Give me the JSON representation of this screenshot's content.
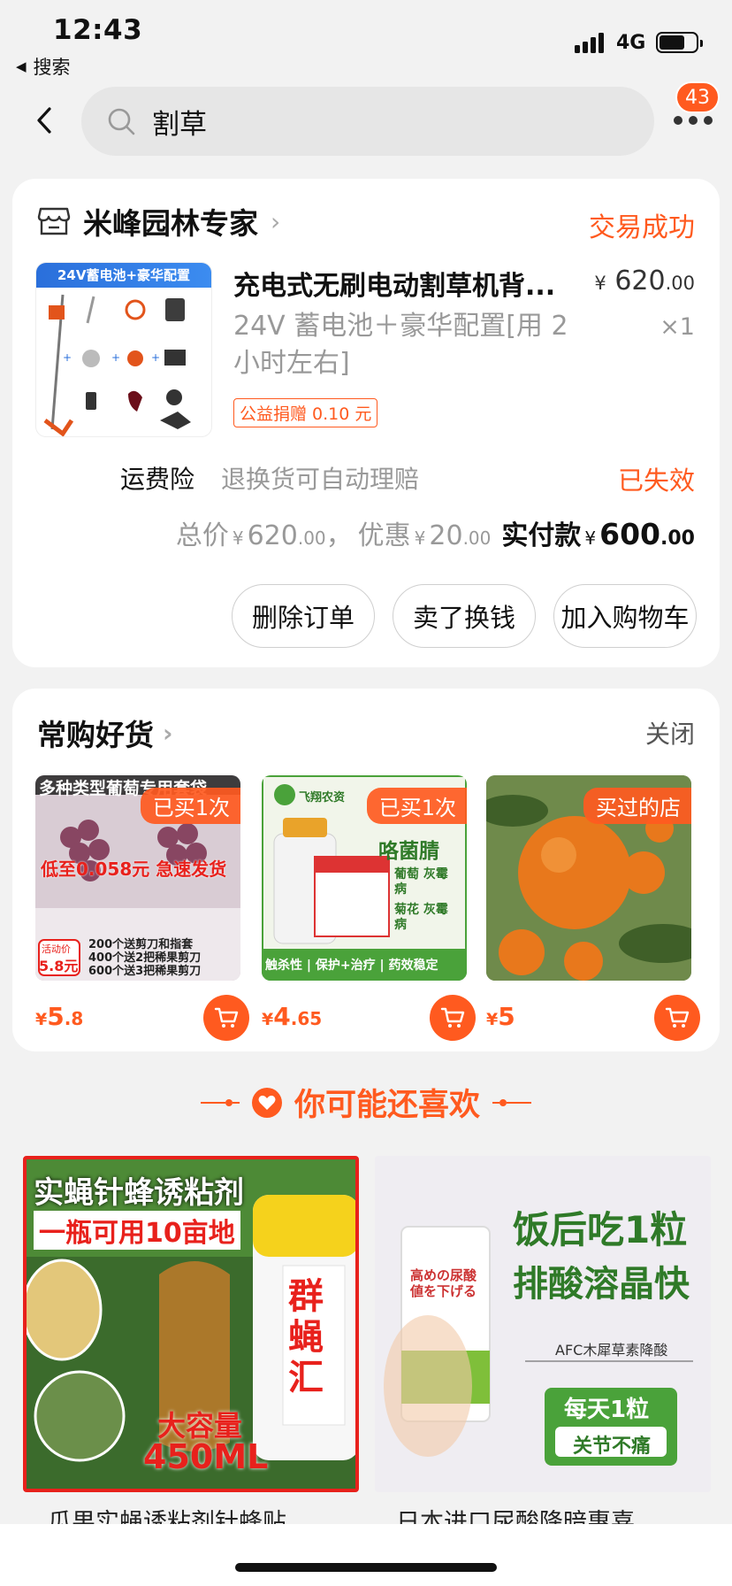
{
  "status_bar": {
    "time": "12:43",
    "back_app": "搜索",
    "network": "4G"
  },
  "header": {
    "search_query": "割草",
    "badge_count": "43"
  },
  "order": {
    "store_name": "米峰园林专家",
    "status": "交易成功",
    "product": {
      "image_banner": "24V蓄电池+豪华配置",
      "title": "充电式无刷电动割草机背...",
      "price_yen": "¥",
      "price_main": "620",
      "price_cents": ".00",
      "sku": "24V 蓄电池＋豪华配置[用 2 小时左右]",
      "qty": "×1",
      "donation": "公益捐赠 0.10 元"
    },
    "insurance": {
      "label": "运费险",
      "desc": "退换货可自动理赔",
      "status": "已失效"
    },
    "totals": {
      "total_label": "总价",
      "total_main": "620",
      "total_cents": ".00",
      "sep": "，",
      "discount_label": "优惠",
      "discount_main": "20",
      "discount_cents": ".00",
      "paid_label": "实付款",
      "paid_main": "600",
      "paid_cents": ".00",
      "yen": "¥"
    },
    "buttons": {
      "delete": "删除订单",
      "sell": "卖了换钱",
      "add_cart": "加入购物车"
    }
  },
  "frequent": {
    "title": "常购好货",
    "close": "关闭",
    "items": [
      {
        "tag": "已买1次",
        "price_symbol": "¥",
        "price_main": "5",
        "price_cents": ".8",
        "img_title": "多种类型葡萄专用套袋",
        "img_sub": "低至0.058元 急速发货",
        "img_promo_label": "活动价",
        "img_promo_price": "5.8元",
        "img_lines": [
          "200个送剪刀和指套",
          "400个送2把稀果剪刀",
          "600个送3把稀果剪刀"
        ]
      },
      {
        "tag": "已买1次",
        "price_symbol": "¥",
        "price_main": "4",
        "price_cents": ".65",
        "img_brand": "飞翔农资",
        "img_product": "咯菌腈",
        "img_use1": "葡萄 灰霉病",
        "img_use2": "菊花 灰霉病",
        "img_footer": "触杀性 | 保护+治疗 | 药效稳定"
      },
      {
        "tag": "买过的店",
        "price_symbol": "¥",
        "price_main": "5",
        "price_cents": ""
      }
    ]
  },
  "recommend": {
    "title": "你可能还喜欢",
    "items": [
      {
        "caption": "瓜果实蝇诱粘剂针蜂贴",
        "img_line1": "实蝇针蜂诱粘剂",
        "img_line2": "一瓶可用10亩地",
        "img_can": "群蝇汇",
        "img_volume1": "大容量",
        "img_volume2": "450ML"
      },
      {
        "caption": "日本进口尿酸降暗惠喜",
        "img_head1": "饭后吃1粒",
        "img_head2": "排酸溶晶快",
        "img_sub": "AFC木犀草素降酸",
        "img_box": "高めの尿酸値を下げる",
        "img_badge1": "每天1粒",
        "img_badge2": "关节不痛"
      }
    ]
  }
}
